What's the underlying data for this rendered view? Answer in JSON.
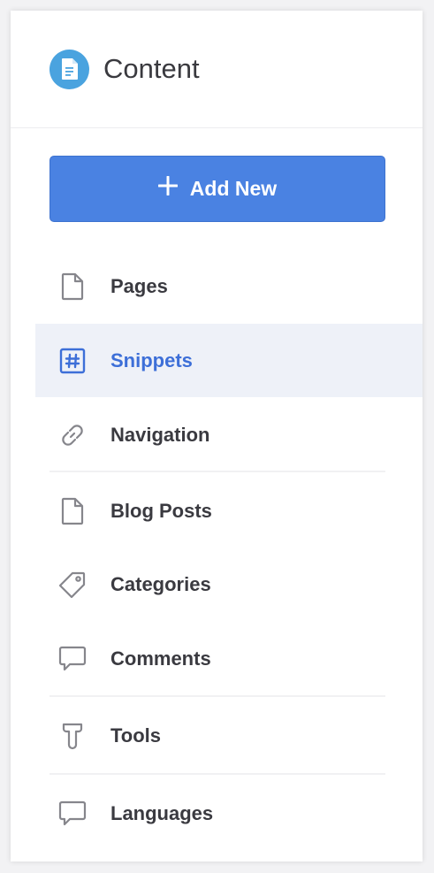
{
  "header": {
    "title": "Content",
    "logo_icon": "document-icon",
    "logo_color": "#4aa3df"
  },
  "add_button": {
    "label": "Add New",
    "plus_icon": "plus-icon",
    "color": "#4a82e2"
  },
  "nav": {
    "active_color": "#3d6fd8",
    "items": [
      {
        "label": "Pages",
        "icon": "page-icon"
      },
      {
        "label": "Snippets",
        "icon": "hash-icon",
        "active": true
      },
      {
        "label": "Navigation",
        "icon": "link-icon"
      },
      {
        "label": "Blog Posts",
        "icon": "page-icon"
      },
      {
        "label": "Categories",
        "icon": "tag-icon"
      },
      {
        "label": "Comments",
        "icon": "comment-icon"
      },
      {
        "label": "Tools",
        "icon": "tool-icon"
      },
      {
        "label": "Languages",
        "icon": "comment-icon"
      }
    ]
  }
}
